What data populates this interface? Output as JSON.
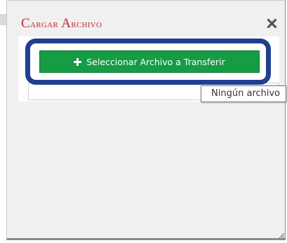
{
  "dialog": {
    "title_initial": "C",
    "title_rest": "argar ",
    "title_initial_2": "A",
    "title_rest_2": "rchivo",
    "close_icon": "close-icon"
  },
  "upload": {
    "button_icon": "plus-icon",
    "button_label": "Seleccionar Archivo a Transferir",
    "tooltip_text": "Ningún archivo"
  },
  "colors": {
    "title": "#c0272d",
    "button": "#169c44",
    "highlight_frame": "#213f8f",
    "close_icon": "#555555"
  }
}
